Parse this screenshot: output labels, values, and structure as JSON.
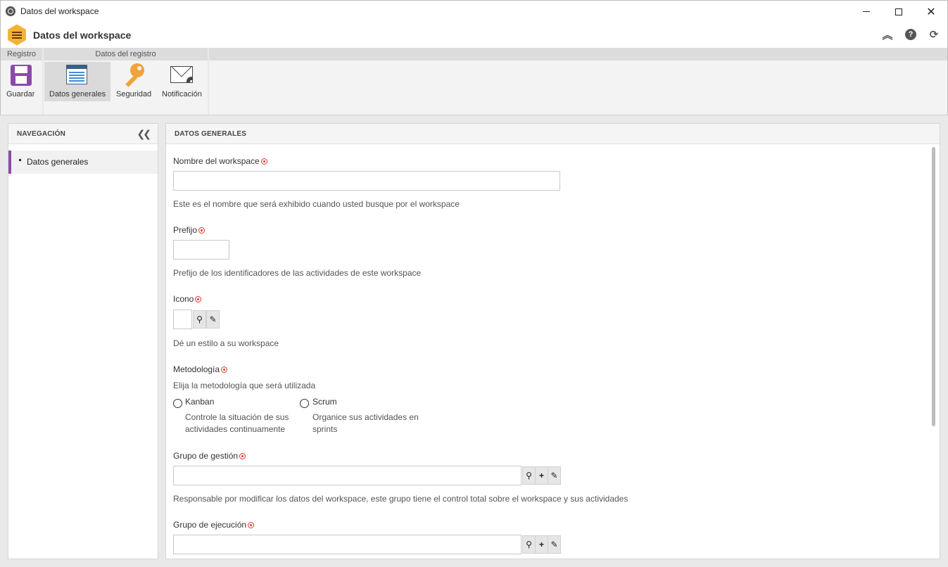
{
  "window": {
    "title": "Datos del workspace"
  },
  "header": {
    "title": "Datos del workspace"
  },
  "ribbon": {
    "groups": [
      {
        "label": "Registro"
      },
      {
        "label": "Datos del registro"
      }
    ],
    "buttons": {
      "save": "Guardar",
      "general": "Datos generales",
      "security": "Seguridad",
      "notification": "Notificación"
    }
  },
  "nav": {
    "title": "NAVEGACIÓN",
    "items": [
      {
        "label": "Datos generales"
      }
    ]
  },
  "content": {
    "title": "DATOS GENERALES",
    "workspace_name": {
      "label": "Nombre del workspace",
      "value": "",
      "hint": "Este es el nombre que será exhibido cuando usted busque por el workspace"
    },
    "prefix": {
      "label": "Prefijo",
      "value": "",
      "hint": "Prefijo de los identificadores de las actividades de este workspace"
    },
    "icon": {
      "label": "Icono",
      "hint": "Dé un estilo a su workspace"
    },
    "methodology": {
      "label": "Metodología",
      "hint": "Elija la metodología que será utilizada",
      "options": [
        {
          "label": "Kanban",
          "desc_line1": "Controle la situación de sus",
          "desc_line2": "actividades continuamente"
        },
        {
          "label": "Scrum",
          "desc_line1": "Organice sus actividades en",
          "desc_line2": "sprints"
        }
      ]
    },
    "management_group": {
      "label": "Grupo de gestión",
      "value": "",
      "hint": "Responsable por modificar los datos del workspace, este grupo tiene el control total sobre el workspace y sus actividades"
    },
    "execution_group": {
      "label": "Grupo de ejecución",
      "value": ""
    }
  },
  "colors": {
    "accent": "#8b4aa8",
    "required": "#d9362b",
    "logo": "#f4b335"
  },
  "icons": [
    "globe-icon",
    "minimize-icon",
    "maximize-icon",
    "close-icon",
    "collapse-up-icon",
    "help-icon",
    "refresh-icon",
    "floppy-disk-icon",
    "form-icon",
    "key-icon",
    "envelope-gear-icon",
    "double-chevron-left-icon",
    "search-icon",
    "plus-icon",
    "eraser-icon",
    "required-icon"
  ]
}
